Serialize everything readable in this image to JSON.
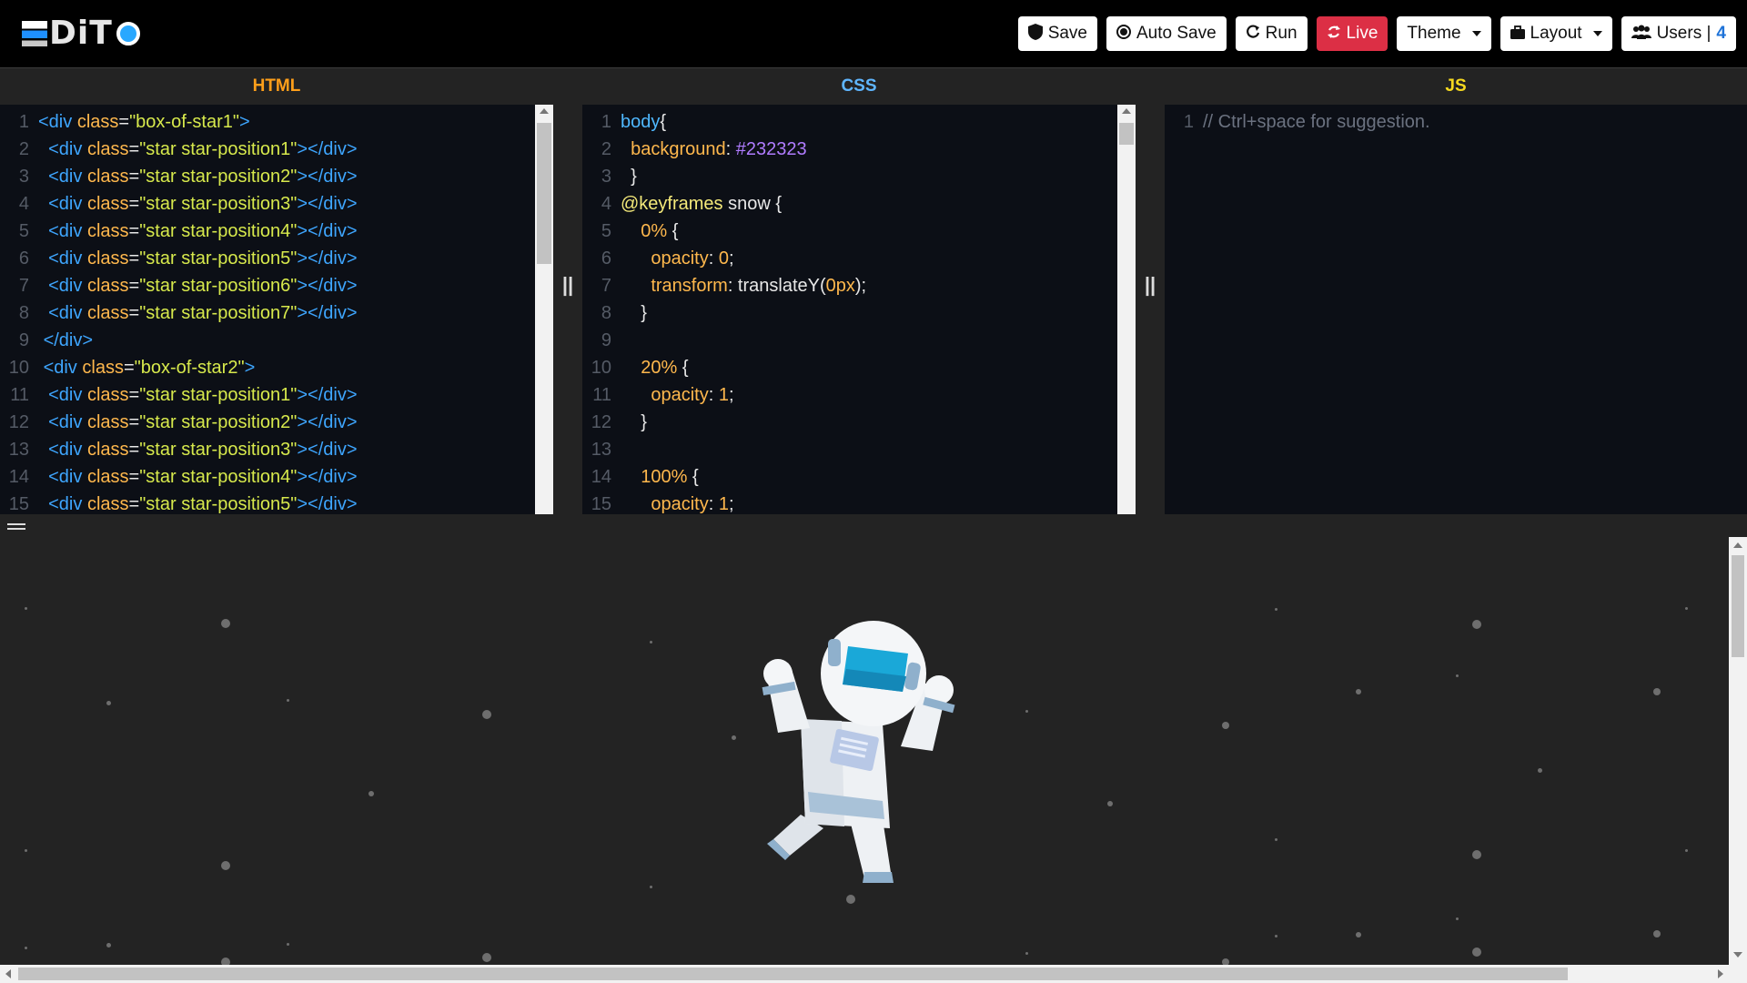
{
  "app": {
    "logo_text": "DiT",
    "accent": "#29a8ff"
  },
  "toolbar": {
    "save": "Save",
    "auto_save": "Auto Save",
    "run": "Run",
    "live": "Live",
    "theme": "Theme",
    "layout": "Layout",
    "users_label": "Users |",
    "users_count": "4"
  },
  "panels": {
    "html_title": "HTML",
    "css_title": "CSS",
    "js_title": "JS",
    "title_colors": {
      "html": "#ff9f1a",
      "css": "#5fb6ff",
      "js": "#f6d91f"
    }
  },
  "html_lines": [
    {
      "n": "1",
      "indent": 0,
      "open": "<div ",
      "attr": "class",
      "eq": "=",
      "val": "\"box-of-star1\"",
      "close": ">"
    },
    {
      "n": "2",
      "indent": 2,
      "open": "<div ",
      "attr": "class",
      "eq": "=",
      "val": "\"star star-position1\"",
      "close": "></div>"
    },
    {
      "n": "3",
      "indent": 2,
      "open": "<div ",
      "attr": "class",
      "eq": "=",
      "val": "\"star star-position2\"",
      "close": "></div>"
    },
    {
      "n": "4",
      "indent": 2,
      "open": "<div ",
      "attr": "class",
      "eq": "=",
      "val": "\"star star-position3\"",
      "close": "></div>"
    },
    {
      "n": "5",
      "indent": 2,
      "open": "<div ",
      "attr": "class",
      "eq": "=",
      "val": "\"star star-position4\"",
      "close": "></div>"
    },
    {
      "n": "6",
      "indent": 2,
      "open": "<div ",
      "attr": "class",
      "eq": "=",
      "val": "\"star star-position5\"",
      "close": "></div>"
    },
    {
      "n": "7",
      "indent": 2,
      "open": "<div ",
      "attr": "class",
      "eq": "=",
      "val": "\"star star-position6\"",
      "close": "></div>"
    },
    {
      "n": "8",
      "indent": 2,
      "open": "<div ",
      "attr": "class",
      "eq": "=",
      "val": "\"star star-position7\"",
      "close": "></div>"
    },
    {
      "n": "9",
      "indent": 1,
      "open": "</div>",
      "attr": "",
      "eq": "",
      "val": "",
      "close": ""
    },
    {
      "n": "10",
      "indent": 1,
      "open": "<div ",
      "attr": "class",
      "eq": "=",
      "val": "\"box-of-star2\"",
      "close": ">"
    },
    {
      "n": "11",
      "indent": 2,
      "open": "<div ",
      "attr": "class",
      "eq": "=",
      "val": "\"star star-position1\"",
      "close": "></div>"
    },
    {
      "n": "12",
      "indent": 2,
      "open": "<div ",
      "attr": "class",
      "eq": "=",
      "val": "\"star star-position2\"",
      "close": "></div>"
    },
    {
      "n": "13",
      "indent": 2,
      "open": "<div ",
      "attr": "class",
      "eq": "=",
      "val": "\"star star-position3\"",
      "close": "></div>"
    },
    {
      "n": "14",
      "indent": 2,
      "open": "<div ",
      "attr": "class",
      "eq": "=",
      "val": "\"star star-position4\"",
      "close": "></div>"
    },
    {
      "n": "15",
      "indent": 2,
      "open": "<div ",
      "attr": "class",
      "eq": "=",
      "val": "\"star star-position5\"",
      "close": "></div>"
    }
  ],
  "css_lines": [
    {
      "n": "1",
      "indent": 0,
      "parts": [
        {
          "cls": "sel",
          "text": "body"
        },
        {
          "cls": "",
          "text": "{"
        }
      ]
    },
    {
      "n": "2",
      "indent": 1,
      "parts": [
        {
          "cls": "prop",
          "text": "background"
        },
        {
          "cls": "",
          "text": ": "
        },
        {
          "cls": "hex",
          "text": "#232323"
        }
      ]
    },
    {
      "n": "3",
      "indent": 1,
      "parts": [
        {
          "cls": "",
          "text": "}"
        }
      ]
    },
    {
      "n": "4",
      "indent": 0,
      "parts": [
        {
          "cls": "kw",
          "text": "@keyframes"
        },
        {
          "cls": "",
          "text": " snow {"
        }
      ]
    },
    {
      "n": "5",
      "indent": 2,
      "parts": [
        {
          "cls": "num",
          "text": "0%"
        },
        {
          "cls": "",
          "text": " {"
        }
      ]
    },
    {
      "n": "6",
      "indent": 3,
      "parts": [
        {
          "cls": "prop",
          "text": "opacity"
        },
        {
          "cls": "",
          "text": ": "
        },
        {
          "cls": "num",
          "text": "0"
        },
        {
          "cls": "",
          "text": ";"
        }
      ]
    },
    {
      "n": "7",
      "indent": 3,
      "parts": [
        {
          "cls": "prop",
          "text": "transform"
        },
        {
          "cls": "",
          "text": ": translateY("
        },
        {
          "cls": "num",
          "text": "0px"
        },
        {
          "cls": "",
          "text": ");"
        }
      ]
    },
    {
      "n": "8",
      "indent": 2,
      "parts": [
        {
          "cls": "",
          "text": "}"
        }
      ]
    },
    {
      "n": "9",
      "indent": 0,
      "parts": []
    },
    {
      "n": "10",
      "indent": 2,
      "parts": [
        {
          "cls": "num",
          "text": "20%"
        },
        {
          "cls": "",
          "text": " {"
        }
      ]
    },
    {
      "n": "11",
      "indent": 3,
      "parts": [
        {
          "cls": "prop",
          "text": "opacity"
        },
        {
          "cls": "",
          "text": ": "
        },
        {
          "cls": "num",
          "text": "1"
        },
        {
          "cls": "",
          "text": ";"
        }
      ]
    },
    {
      "n": "12",
      "indent": 2,
      "parts": [
        {
          "cls": "",
          "text": "}"
        }
      ]
    },
    {
      "n": "13",
      "indent": 0,
      "parts": []
    },
    {
      "n": "14",
      "indent": 2,
      "parts": [
        {
          "cls": "num",
          "text": "100%"
        },
        {
          "cls": "",
          "text": " {"
        }
      ]
    },
    {
      "n": "15",
      "indent": 3,
      "parts": [
        {
          "cls": "prop",
          "text": "opacity"
        },
        {
          "cls": "",
          "text": ": "
        },
        {
          "cls": "num",
          "text": "1"
        },
        {
          "cls": "",
          "text": ";"
        }
      ]
    }
  ],
  "js_lines": [
    {
      "n": "1",
      "text": "// Ctrl+space for suggestion."
    }
  ],
  "icons": {
    "save": "shield-icon",
    "auto_save": "record-icon",
    "run": "redo-icon",
    "live": "sync-icon",
    "layout": "briefcase-icon",
    "users": "users-icon"
  }
}
